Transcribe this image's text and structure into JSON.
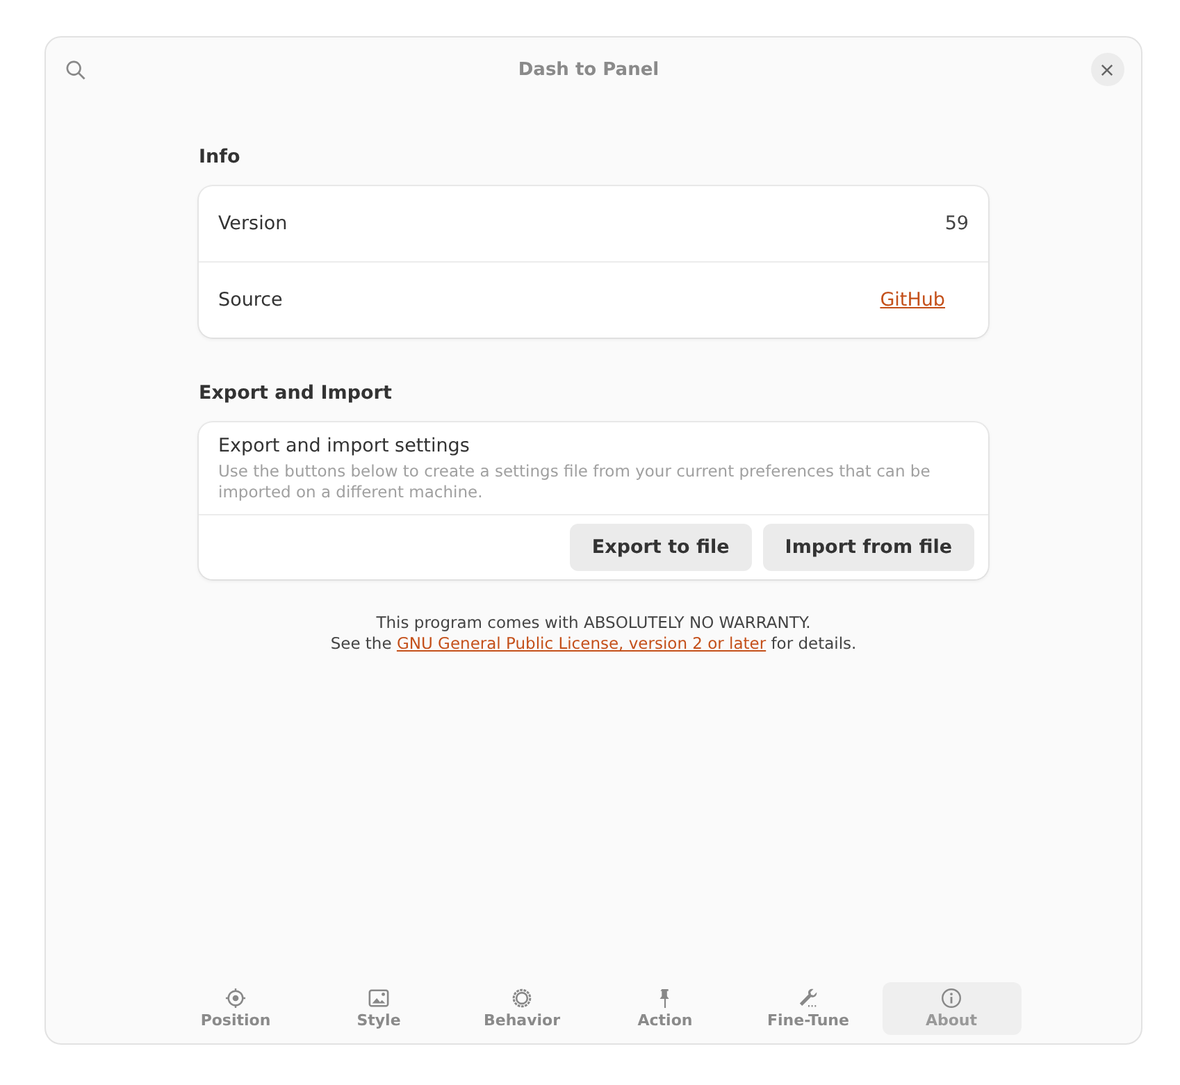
{
  "window": {
    "title": "Dash to Panel"
  },
  "sections": [
    {
      "title": "Info",
      "rows": [
        {
          "kind": "value",
          "label": "Version",
          "value": "59"
        },
        {
          "kind": "link",
          "label": "Source",
          "value": "GitHub"
        }
      ]
    },
    {
      "title": "Export and Import",
      "rows": [
        {
          "kind": "actions",
          "label": "Export and import settings",
          "description": "Use the buttons below to create a settings file from your current preferences that can be imported on a different machine.",
          "buttons": [
            "Export to file",
            "Import from file"
          ]
        }
      ]
    }
  ],
  "footer": {
    "line_1": "This program comes with ABSOLUTELY NO WARRANTY.",
    "prefix": "See the",
    "link": "GNU General Public License, version 2 or later",
    "suffix": "for details."
  },
  "tabs": [
    {
      "label": "Position",
      "selected": false
    },
    {
      "label": "Style",
      "selected": false
    },
    {
      "label": "Behavior",
      "selected": false
    },
    {
      "label": "Action",
      "selected": false
    },
    {
      "label": "Fine-Tune",
      "selected": false
    },
    {
      "label": "About",
      "selected": true
    }
  ]
}
